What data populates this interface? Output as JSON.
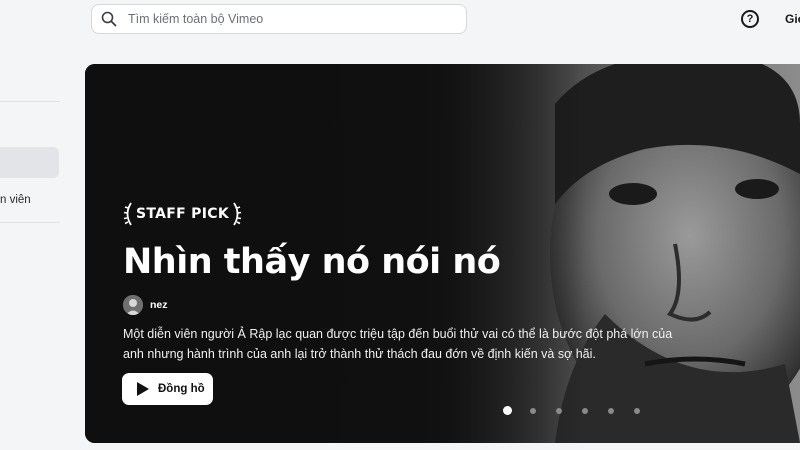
{
  "search": {
    "placeholder": "Tìm kiếm toàn bộ Vimeo",
    "icon": "search-icon"
  },
  "header": {
    "help_icon": "help-circle-icon",
    "help_glyph": "?",
    "nav_cut_label": "Giới"
  },
  "sidebar": {
    "partial_label": "n viên"
  },
  "hero": {
    "badge_text": "STAFF PICK",
    "title": "Nhìn thấy nó nói nó",
    "creator_name": "nez",
    "description": "Một diễn viên người Ả Rập lạc quan được triệu tập đến buổi thử vai có thể là bước đột phá lớn của anh nhưng hành trình của anh lại trở thành thử thách đau đớn về định kiến và sợ hãi.",
    "watch_label": "Đồng hồ",
    "play_icon": "play-icon",
    "carousel": {
      "count": 6,
      "active_index": 0
    }
  }
}
